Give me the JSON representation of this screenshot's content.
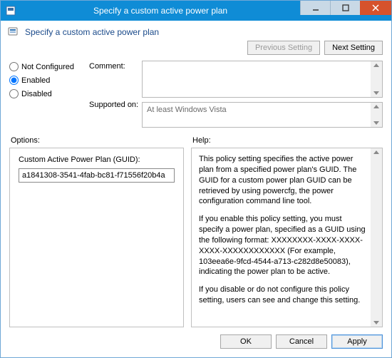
{
  "window": {
    "title": "Specify a custom active power plan"
  },
  "header": {
    "title": "Specify a custom active power plan"
  },
  "nav": {
    "prev": "Previous Setting",
    "next": "Next Setting"
  },
  "radios": {
    "not_configured": "Not Configured",
    "enabled": "Enabled",
    "disabled": "Disabled",
    "selected": "enabled"
  },
  "labels": {
    "comment": "Comment:",
    "supported": "Supported on:"
  },
  "fields": {
    "comment": "",
    "supported": "At least Windows Vista"
  },
  "columns": {
    "options": "Options:",
    "help": "Help:"
  },
  "options": {
    "guid_label": "Custom Active Power Plan (GUID):",
    "guid_value": "a1841308-3541-4fab-bc81-f71556f20b4a"
  },
  "help": {
    "p1": "This policy setting specifies the active power plan from a specified power plan's GUID. The GUID for a custom power plan GUID can be retrieved by using powercfg, the power configuration command line tool.",
    "p2": "If you enable this policy setting, you must specify a power plan, specified as a GUID using the following format: XXXXXXXX-XXXX-XXXX-XXXX-XXXXXXXXXXXX (For example, 103eea6e-9fcd-4544-a713-c282d8e50083), indicating the power plan to be active.",
    "p3": "If you disable or do not configure this policy setting, users can see and change this setting."
  },
  "footer": {
    "ok": "OK",
    "cancel": "Cancel",
    "apply": "Apply"
  }
}
